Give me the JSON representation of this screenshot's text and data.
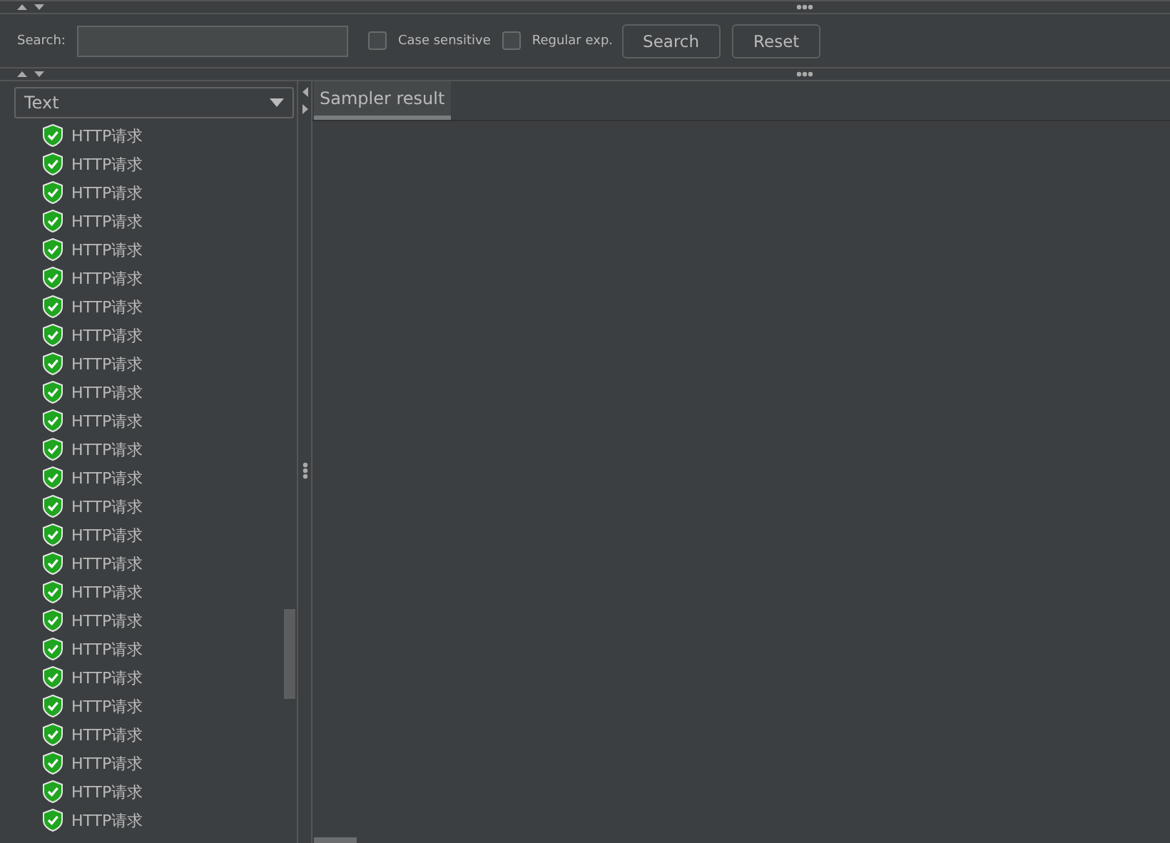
{
  "search_bar": {
    "label": "Search:",
    "case_sensitive": {
      "label": "Case sensitive",
      "checked": false
    },
    "regular_exp": {
      "label": "Regular exp.",
      "checked": false
    },
    "buttons": [
      "Search",
      "Reset"
    ]
  },
  "renderer": {
    "value": "Text"
  },
  "results": [
    {
      "label": "HTTP请求",
      "success": true
    },
    {
      "label": "HTTP请求",
      "success": true
    },
    {
      "label": "HTTP请求",
      "success": true
    },
    {
      "label": "HTTP请求",
      "success": true
    },
    {
      "label": "HTTP请求",
      "success": true
    },
    {
      "label": "HTTP请求",
      "success": true
    },
    {
      "label": "HTTP请求",
      "success": true
    },
    {
      "label": "HTTP请求",
      "success": true
    },
    {
      "label": "HTTP请求",
      "success": true
    },
    {
      "label": "HTTP请求",
      "success": true
    },
    {
      "label": "HTTP请求",
      "success": true
    },
    {
      "label": "HTTP请求",
      "success": true
    },
    {
      "label": "HTTP请求",
      "success": true
    },
    {
      "label": "HTTP请求",
      "success": true
    },
    {
      "label": "HTTP请求",
      "success": true
    },
    {
      "label": "HTTP请求",
      "success": true
    },
    {
      "label": "HTTP请求",
      "success": true
    },
    {
      "label": "HTTP请求",
      "success": true
    },
    {
      "label": "HTTP请求",
      "success": true
    },
    {
      "label": "HTTP请求",
      "success": true
    },
    {
      "label": "HTTP请求",
      "success": true
    },
    {
      "label": "HTTP请求",
      "success": true
    },
    {
      "label": "HTTP请求",
      "success": true
    },
    {
      "label": "HTTP请求",
      "success": true
    },
    {
      "label": "HTTP请求",
      "success": true
    }
  ],
  "tabs": [
    {
      "label": "Sampler result",
      "selected": true
    }
  ]
}
